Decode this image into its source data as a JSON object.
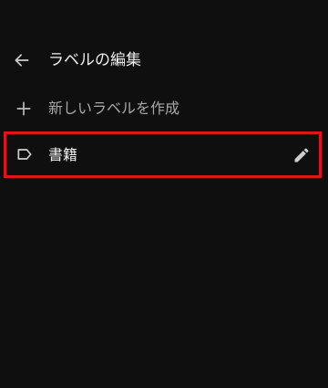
{
  "header": {
    "title": "ラベルの編集",
    "back_icon": "arrow-left-icon"
  },
  "create": {
    "label": "新しいラベルを作成",
    "icon": "plus-icon"
  },
  "labels": [
    {
      "name": "書籍",
      "icon": "label-tag-icon",
      "action_icon": "pencil-icon"
    }
  ],
  "colors": {
    "background": "#0f0f0f",
    "highlight": "#e0141b"
  }
}
